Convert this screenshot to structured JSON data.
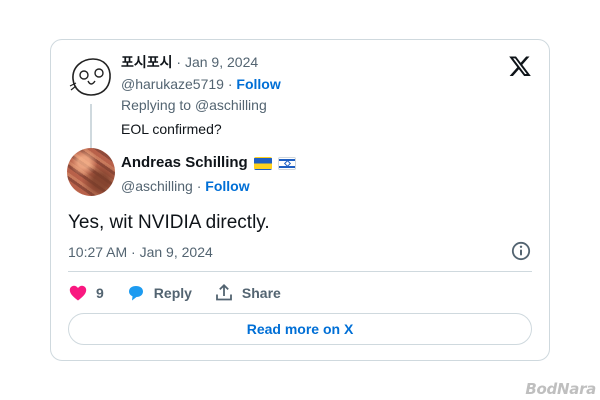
{
  "parent": {
    "name": "포시포시",
    "date": "· Jan 9, 2024",
    "handle": "@harukaze5719",
    "separator": " · ",
    "follow": "Follow",
    "replying_prefix": "Replying to ",
    "replying_to": "@aschilling",
    "text": "EOL confirmed?"
  },
  "tweet": {
    "author_name": "Andreas Schilling",
    "handle": "@aschilling",
    "separator": " · ",
    "follow": "Follow",
    "text": "Yes, wit NVIDIA directly.",
    "timestamp": "10:27 AM · Jan 9, 2024",
    "flags": [
      "ukraine-flag",
      "israel-flag"
    ]
  },
  "actions": {
    "likes_count": "9",
    "reply_label": "Reply",
    "share_label": "Share"
  },
  "read_more_label": "Read more on X",
  "watermark": "BodNara",
  "colors": {
    "link": "#006fd6",
    "heart": "#f91880",
    "reply_bubble": "#1d9bf0",
    "muted_text": "#536471",
    "border": "#cfd9de"
  },
  "icons": [
    "x-logo-icon",
    "info-icon",
    "heart-icon",
    "reply-bubble-icon",
    "share-icon"
  ]
}
